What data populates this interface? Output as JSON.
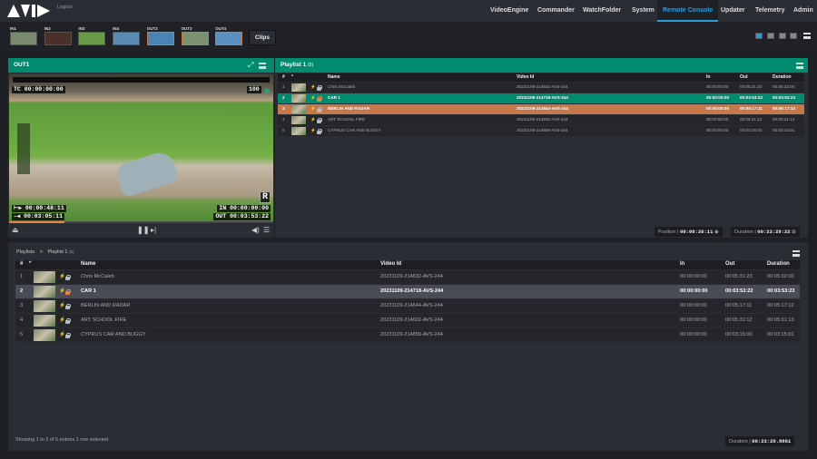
{
  "header": {
    "logout": "Logout",
    "nav": [
      "VideoEngine",
      "Commander",
      "WatchFolder",
      "System",
      "Remote Console",
      "Updater",
      "Telemetry",
      "Admin"
    ],
    "active": "Remote Console"
  },
  "sources": [
    {
      "label": "IN1",
      "out": false,
      "bg": "#7a8a70"
    },
    {
      "label": "IN2",
      "out": false,
      "bg": "#4a3028"
    },
    {
      "label": "IN3",
      "out": false,
      "bg": "#6a9a48"
    },
    {
      "label": "IN4",
      "out": false,
      "bg": "#5a8ab0"
    },
    {
      "label": "OUT2",
      "out": true,
      "bg": "#4a84b4"
    },
    {
      "label": "OUT3",
      "out": true,
      "bg": "#7a9070"
    },
    {
      "label": "OUT4",
      "out": true,
      "bg": "#5a90c0"
    }
  ],
  "clips_label": "Clips",
  "player": {
    "title": "OUT1",
    "tc": "TC 00:00:00:00",
    "volume": "100",
    "r": "R",
    "elapsed": "00:00:48:11",
    "remaining": "00:03:05:11",
    "in": "IN 00:00:00:00",
    "out": "OUT 00:03:53:22",
    "progress": 0.21
  },
  "playlist": {
    "title": "Playlist 1",
    "count": "(5)",
    "columns": [
      "#",
      "*",
      "Name",
      "Video Id",
      "In",
      "Out",
      "Duration"
    ],
    "rows": [
      {
        "n": "1",
        "name": "Chris McCaleb",
        "vid": "20231109-214832-AVS-244",
        "in": "00:00:00:00",
        "out": "00:05:31:23",
        "dur": "00:05:32:00",
        "state": "",
        "lock": ""
      },
      {
        "n": "2",
        "name": "CAR 1",
        "vid": "20231109-214718-AVS-244",
        "in": "00:00:00:00",
        "out": "00:03:53:22",
        "dur": "00:03:53:23",
        "state": "playing",
        "lock": "orange"
      },
      {
        "n": "3",
        "name": "BERLIN AND RADAR",
        "vid": "20231109-214644-AVS-244",
        "in": "00:00:00:00",
        "out": "00:05:17:11",
        "dur": "00:05:17:12",
        "state": "next",
        "lock": ""
      },
      {
        "n": "4",
        "name": "ART SCHOOL FIRE",
        "vid": "20231109-214602-AVS-244",
        "in": "00:00:00:00",
        "out": "00:05:31:12",
        "dur": "00:05:31:13",
        "state": "",
        "lock": ""
      },
      {
        "n": "5",
        "name": "CYPRUS CAR AND BUGGY",
        "vid": "20231109-214859-AVS-244",
        "in": "00:00:00:00",
        "out": "00:03:15:00",
        "dur": "00:03:15:01",
        "state": "",
        "lock": ""
      }
    ],
    "position_label": "Position",
    "position": "00:06:20:11",
    "duration_label": "Duration",
    "duration": "00:23:29:22"
  },
  "library": {
    "breadcrumb_root": "Playlists",
    "breadcrumb_sep": ">",
    "breadcrumb_current": "Playlist 1",
    "count": "(5)",
    "footer": "Showing 1 to 5 of 5 entries   1 row selected",
    "duration_label": "Duration",
    "duration": "00:23:29.8861",
    "selected_row": 1
  },
  "colors": {
    "green": "#008a6e",
    "orange": "#c6784a",
    "accent": "#2a9bd9"
  }
}
